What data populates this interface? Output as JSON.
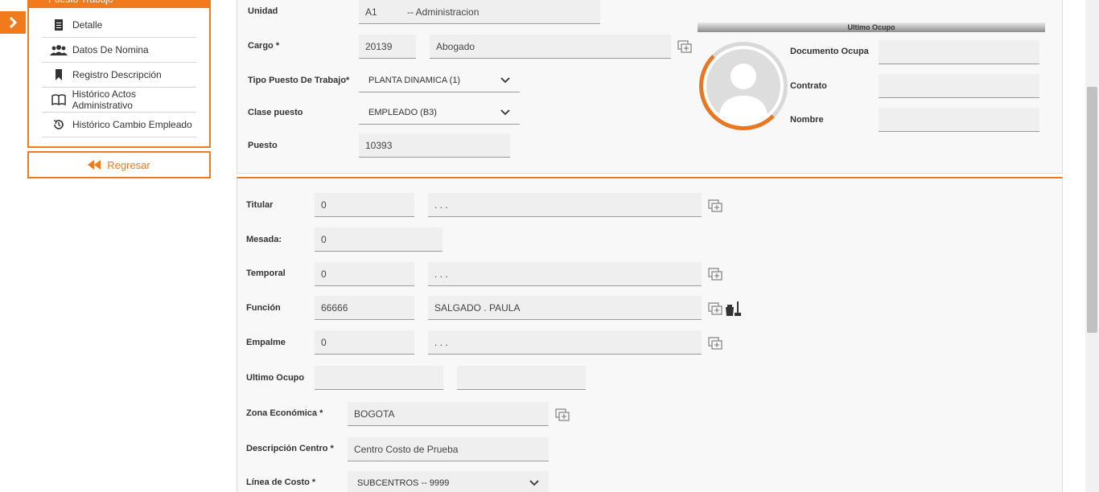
{
  "sidebar": {
    "header": "Puesto Trabajo",
    "items": [
      {
        "label": "Detalle",
        "icon": "document-icon"
      },
      {
        "label": "Datos De Nomina",
        "icon": "users-icon"
      },
      {
        "label": "Registro Descripción",
        "icon": "bookmark-icon"
      },
      {
        "label": "Histórico Actos Administrativo",
        "icon": "book-icon"
      },
      {
        "label": "Histórico Cambio Empleado",
        "icon": "history-icon"
      }
    ],
    "back_label": "Regresar"
  },
  "top": {
    "unidad": {
      "label": "Unidad",
      "code": "A1",
      "name": "-- Administracion"
    },
    "cargo": {
      "label": "Cargo *",
      "code": "20139",
      "name": "Abogado"
    },
    "tipo_puesto": {
      "label": "Tipo Puesto De Trabajo*",
      "value": "PLANTA DINAMICA (1)"
    },
    "clase_puesto": {
      "label": "Clase puesto",
      "value": "EMPLEADO (B3)"
    },
    "puesto": {
      "label": "Puesto",
      "value": "10393"
    },
    "ultimo_ocupo": {
      "title": "Ultimo Ocupo",
      "documento_label": "Documento Ocupa",
      "documento_value": "",
      "contrato_label": "Contrato",
      "contrato_value": "",
      "nombre_label": "Nombre",
      "nombre_value": ""
    }
  },
  "bottom": {
    "titular": {
      "label": "Titular",
      "code": "0",
      "name": ". . ."
    },
    "mesada": {
      "label": "Mesada:",
      "value": "0"
    },
    "temporal": {
      "label": "Temporal",
      "code": "0",
      "name": ". . ."
    },
    "funcion": {
      "label": "Función",
      "code": "66666",
      "name": "SALGADO . PAULA"
    },
    "empalme": {
      "label": "Empalme",
      "code": "0",
      "name": ". . ."
    },
    "ultimo_ocupo": {
      "label": "Ultimo Ocupo",
      "code": "",
      "name": ""
    },
    "zona": {
      "label": "Zona Económica *",
      "value": "BOGOTA"
    },
    "descripcion_centro": {
      "label": "Descripción Centro *",
      "value": "Centro Costo de Prueba"
    },
    "linea_costo": {
      "label": "Línea de Costo *",
      "value": "SUBCENTROS -- 9999"
    }
  },
  "colors": {
    "accent": "#f07a1c",
    "field_bg": "#efefef",
    "panel_bg": "#f8f8f8"
  }
}
